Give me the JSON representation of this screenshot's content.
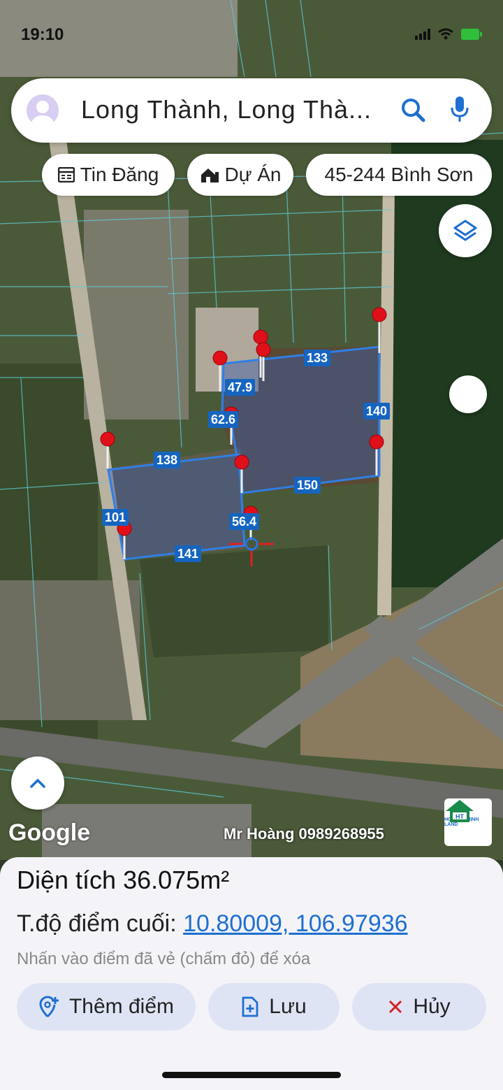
{
  "status_bar": {
    "time": "19:10"
  },
  "search": {
    "text": "Long Thành, Long Thà..."
  },
  "chips": [
    {
      "label": "Tin Đăng",
      "icon": "listing-icon"
    },
    {
      "label": "Dự Án",
      "icon": "project-icon"
    },
    {
      "label": "45-244 Bình Sơn",
      "icon": ""
    }
  ],
  "map": {
    "segment_labels": [
      "133",
      "47.9",
      "62.6",
      "140",
      "138",
      "150",
      "101",
      "56.4",
      "141"
    ],
    "google": "Google",
    "watermark": "Mr Hoàng 0989268955",
    "logo_text": "HOÀNG THỊNH LAND",
    "parcel_color": "#1565c0",
    "pin_color": "#e0101a"
  },
  "panel": {
    "area_label": "Diện tích",
    "area_value": "36.075m²",
    "coord_label": "T.độ điểm cuối:",
    "coord_value": "10.80009, 106.97936",
    "hint": "Nhấn vào điểm đã vẻ (chấm đỏ) để xóa",
    "buttons": {
      "add": "Thêm điểm",
      "save": "Lưu",
      "cancel": "Hủy"
    }
  }
}
